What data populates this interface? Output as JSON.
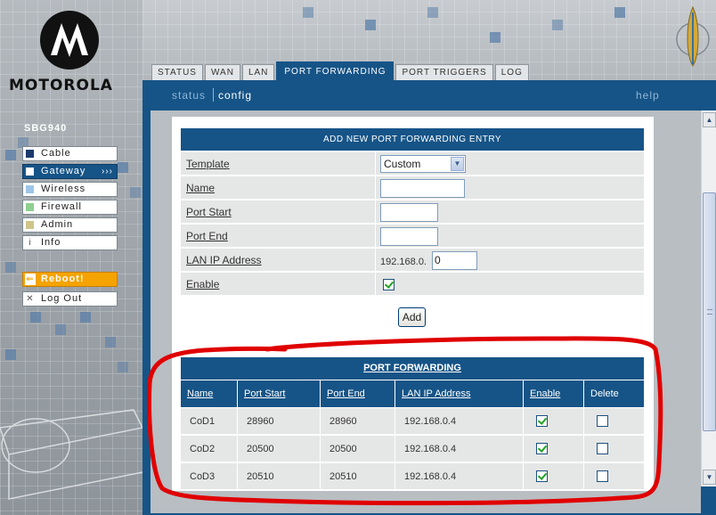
{
  "brand": {
    "name": "MOTOROLA"
  },
  "device": {
    "model": "SBG940"
  },
  "sidebar": {
    "items": [
      {
        "label": "Cable",
        "color": "#1b3a6b"
      },
      {
        "label": "Gateway",
        "arrows": "›››",
        "color": "#ffffff"
      },
      {
        "label": "Wireless",
        "color": "#9ec6ea"
      },
      {
        "label": "Firewall",
        "color": "#8fcf8f"
      },
      {
        "label": "Admin",
        "color": "#cfc58a"
      },
      {
        "label": "Info",
        "glyph": "i"
      }
    ],
    "reboot": {
      "label": "Reboot!"
    },
    "logout": {
      "label": "Log Out"
    }
  },
  "tabs": [
    {
      "label": "STATUS"
    },
    {
      "label": "WAN"
    },
    {
      "label": "LAN"
    },
    {
      "label": "PORT FORWARDING",
      "active": true
    },
    {
      "label": "PORT TRIGGERS"
    },
    {
      "label": "LOG"
    }
  ],
  "subnav": {
    "status": "status",
    "config": "config",
    "help": "help"
  },
  "form": {
    "title": "ADD NEW PORT FORWARDING ENTRY",
    "template_label": "Template",
    "template_value": "Custom",
    "name_label": "Name",
    "port_start_label": "Port Start",
    "port_end_label": "Port End",
    "lan_ip_label": "LAN IP Address",
    "lan_ip_prefix": "192.168.0.",
    "lan_ip_value": "0",
    "enable_label": "Enable",
    "enable_checked": true,
    "add_button": "Add"
  },
  "port_forwarding": {
    "title": "PORT FORWARDING",
    "columns": [
      "Name",
      "Port Start",
      "Port End",
      "LAN IP Address",
      "Enable",
      "Delete"
    ],
    "rows": [
      {
        "name": "CoD1",
        "port_start": "28960",
        "port_end": "28960",
        "lan_ip": "192.168.0.4",
        "enable": true,
        "delete": false
      },
      {
        "name": "CoD2",
        "port_start": "20500",
        "port_end": "20500",
        "lan_ip": "192.168.0.4",
        "enable": true,
        "delete": false
      },
      {
        "name": "CoD3",
        "port_start": "20510",
        "port_end": "20510",
        "lan_ip": "192.168.0.4",
        "enable": true,
        "delete": false
      }
    ]
  },
  "colors": {
    "brand_blue": "#165487",
    "row_gray": "#e5e6e6",
    "reboot_orange": "#f5a300",
    "annotation_red": "#e00000"
  }
}
